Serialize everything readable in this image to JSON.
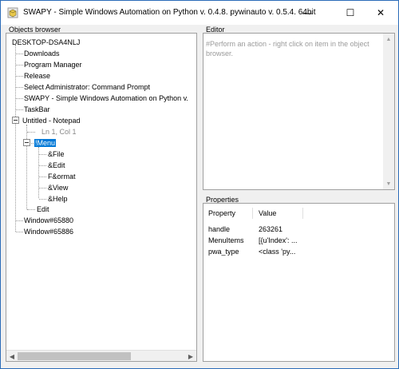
{
  "window": {
    "title": "SWAPY - Simple Windows Automation on Python v. 0.4.8. pywinauto v. 0.5.4. 64bit",
    "minimize_glyph": "—",
    "maximize_glyph": "☐",
    "close_glyph": "✕"
  },
  "object_browser": {
    "label": "Objects browser",
    "root": "DESKTOP-DSA4NLJ",
    "items": [
      "Downloads",
      "Program Manager",
      "Release",
      "Select Administrator: Command Prompt",
      "SWAPY - Simple Windows Automation on Python v.",
      "TaskBar",
      "Untitled - Notepad"
    ],
    "notepad_children": {
      "ln_col": "Ln 1, Col 1",
      "menu": "!Menu",
      "menu_items": [
        "&File",
        "&Edit",
        "F&ormat",
        "&View",
        "&Help"
      ],
      "edit": "Edit"
    },
    "trailing_items": [
      "Window#65880",
      "Window#65886"
    ]
  },
  "editor": {
    "label": "Editor",
    "placeholder": "#Perform an action - right click on item in the object browser."
  },
  "properties": {
    "label": "Properties",
    "columns": [
      "Property",
      "Value"
    ],
    "rows": [
      {
        "property": "handle",
        "value": "263261"
      },
      {
        "property": "MenuItems",
        "value": "[{u'Index': ..."
      },
      {
        "property": "pwa_type",
        "value": "<class 'py..."
      }
    ]
  },
  "colors": {
    "selection": "#0078d7",
    "border": "#2b6cb8"
  }
}
